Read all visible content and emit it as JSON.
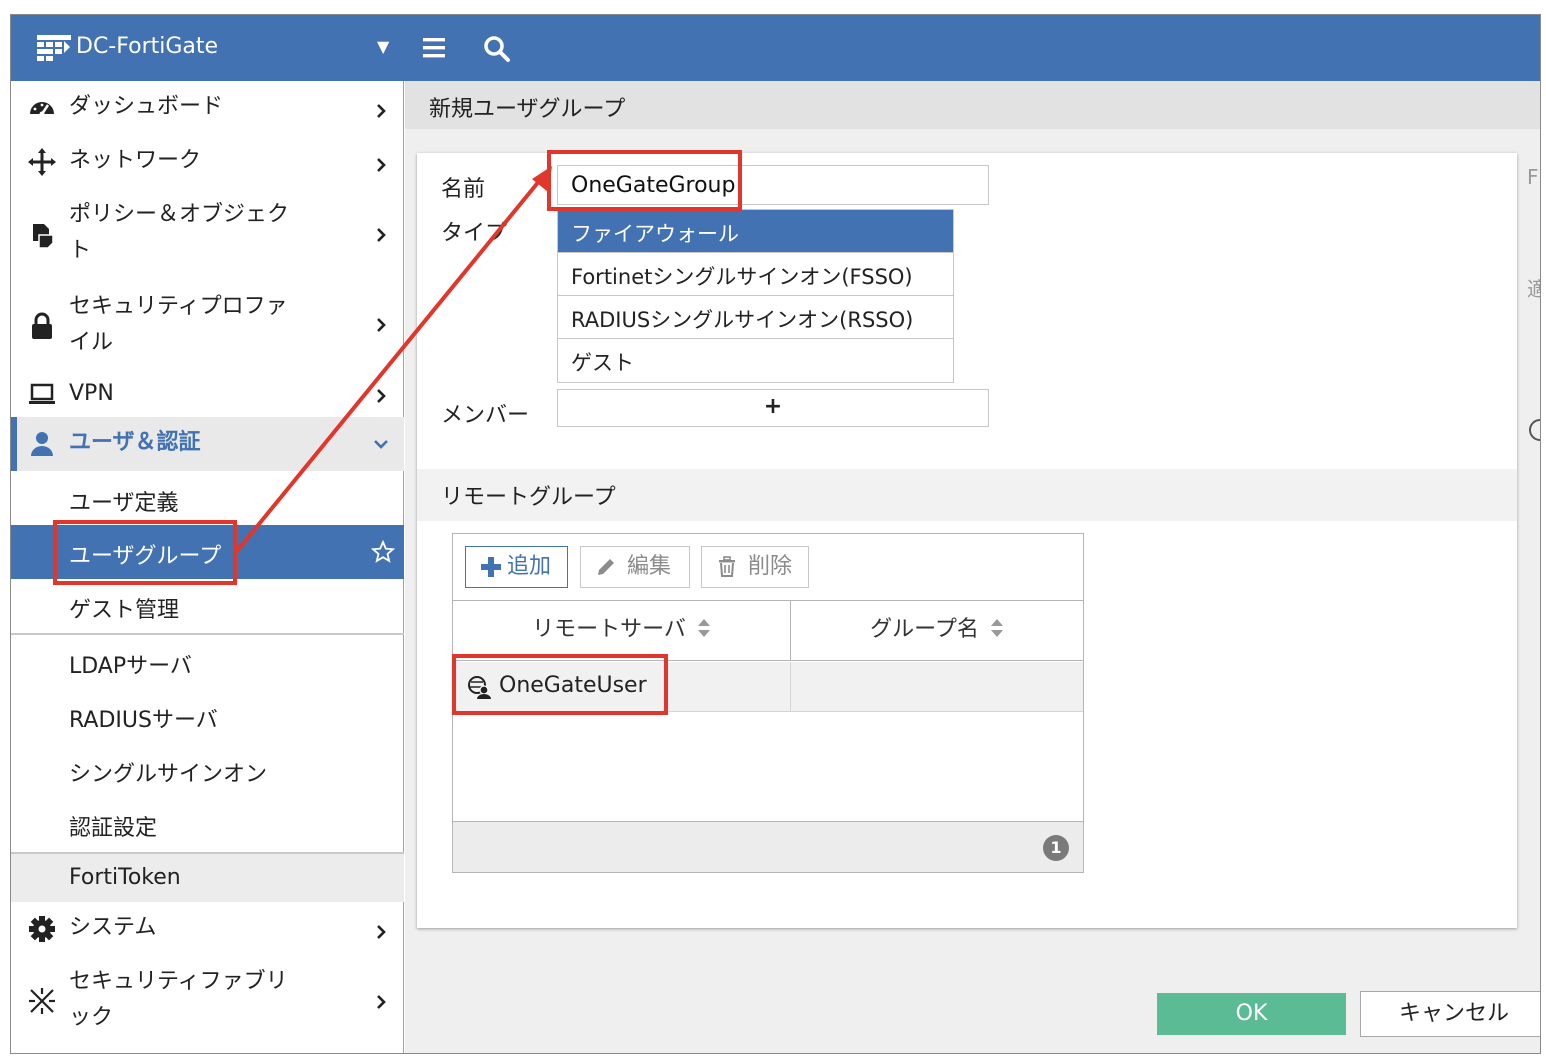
{
  "header": {
    "title": "DC-FortiGate"
  },
  "sidebar": {
    "items": [
      {
        "label": "ダッシュボード",
        "icon": "dashboard-icon"
      },
      {
        "label": "ネットワーク",
        "icon": "network-icon"
      },
      {
        "label": "ポリシー＆オブジェクト",
        "line1": "ポリシー＆オブジェク",
        "line2": "ト",
        "icon": "policy-icon"
      },
      {
        "label": "セキュリティプロファイル",
        "line1": "セキュリティプロファ",
        "line2": "イル",
        "icon": "lock-icon"
      },
      {
        "label": "VPN",
        "icon": "laptop-icon"
      },
      {
        "label": "ユーザ＆認証",
        "icon": "user-icon",
        "expanded": true
      },
      {
        "label": "システム",
        "icon": "gear-icon"
      },
      {
        "label": "セキュリティファブリック",
        "line1": "セキュリティファブリ",
        "line2": "ック",
        "icon": "fabric-icon"
      }
    ],
    "subitems": [
      {
        "label": "ユーザ定義"
      },
      {
        "label": "ユーザグループ",
        "selected": true
      },
      {
        "label": "ゲスト管理"
      },
      {
        "label": "LDAPサーバ"
      },
      {
        "label": "RADIUSサーバ"
      },
      {
        "label": "シングルサインオン"
      },
      {
        "label": "認証設定"
      },
      {
        "label": "FortiToken"
      }
    ]
  },
  "main": {
    "title": "新規ユーザグループ",
    "form": {
      "name_label": "名前",
      "name_value": "OneGateGroup",
      "type_label": "タイプ",
      "type_options": [
        {
          "label": "ファイアウォール",
          "selected": true
        },
        {
          "label": "Fortinetシングルサインオン(FSSO)"
        },
        {
          "label": "RADIUSシングルサインオン(RSSO)"
        },
        {
          "label": "ゲスト"
        }
      ],
      "member_label": "メンバー",
      "member_add": "+"
    },
    "remote": {
      "title": "リモートグループ",
      "add_label": "追加",
      "edit_label": "編集",
      "delete_label": "削除",
      "columns": [
        "リモートサーバ",
        "グループ名"
      ],
      "rows": [
        {
          "server": "OneGateUser",
          "group": ""
        }
      ],
      "count": "1"
    },
    "side_chars": [
      "F",
      "適"
    ],
    "ok_label": "OK",
    "cancel_label": "キャンセル"
  },
  "colors": {
    "brand": "#4272b2",
    "ok": "#5bbb95",
    "annotation": "#e0362b"
  }
}
